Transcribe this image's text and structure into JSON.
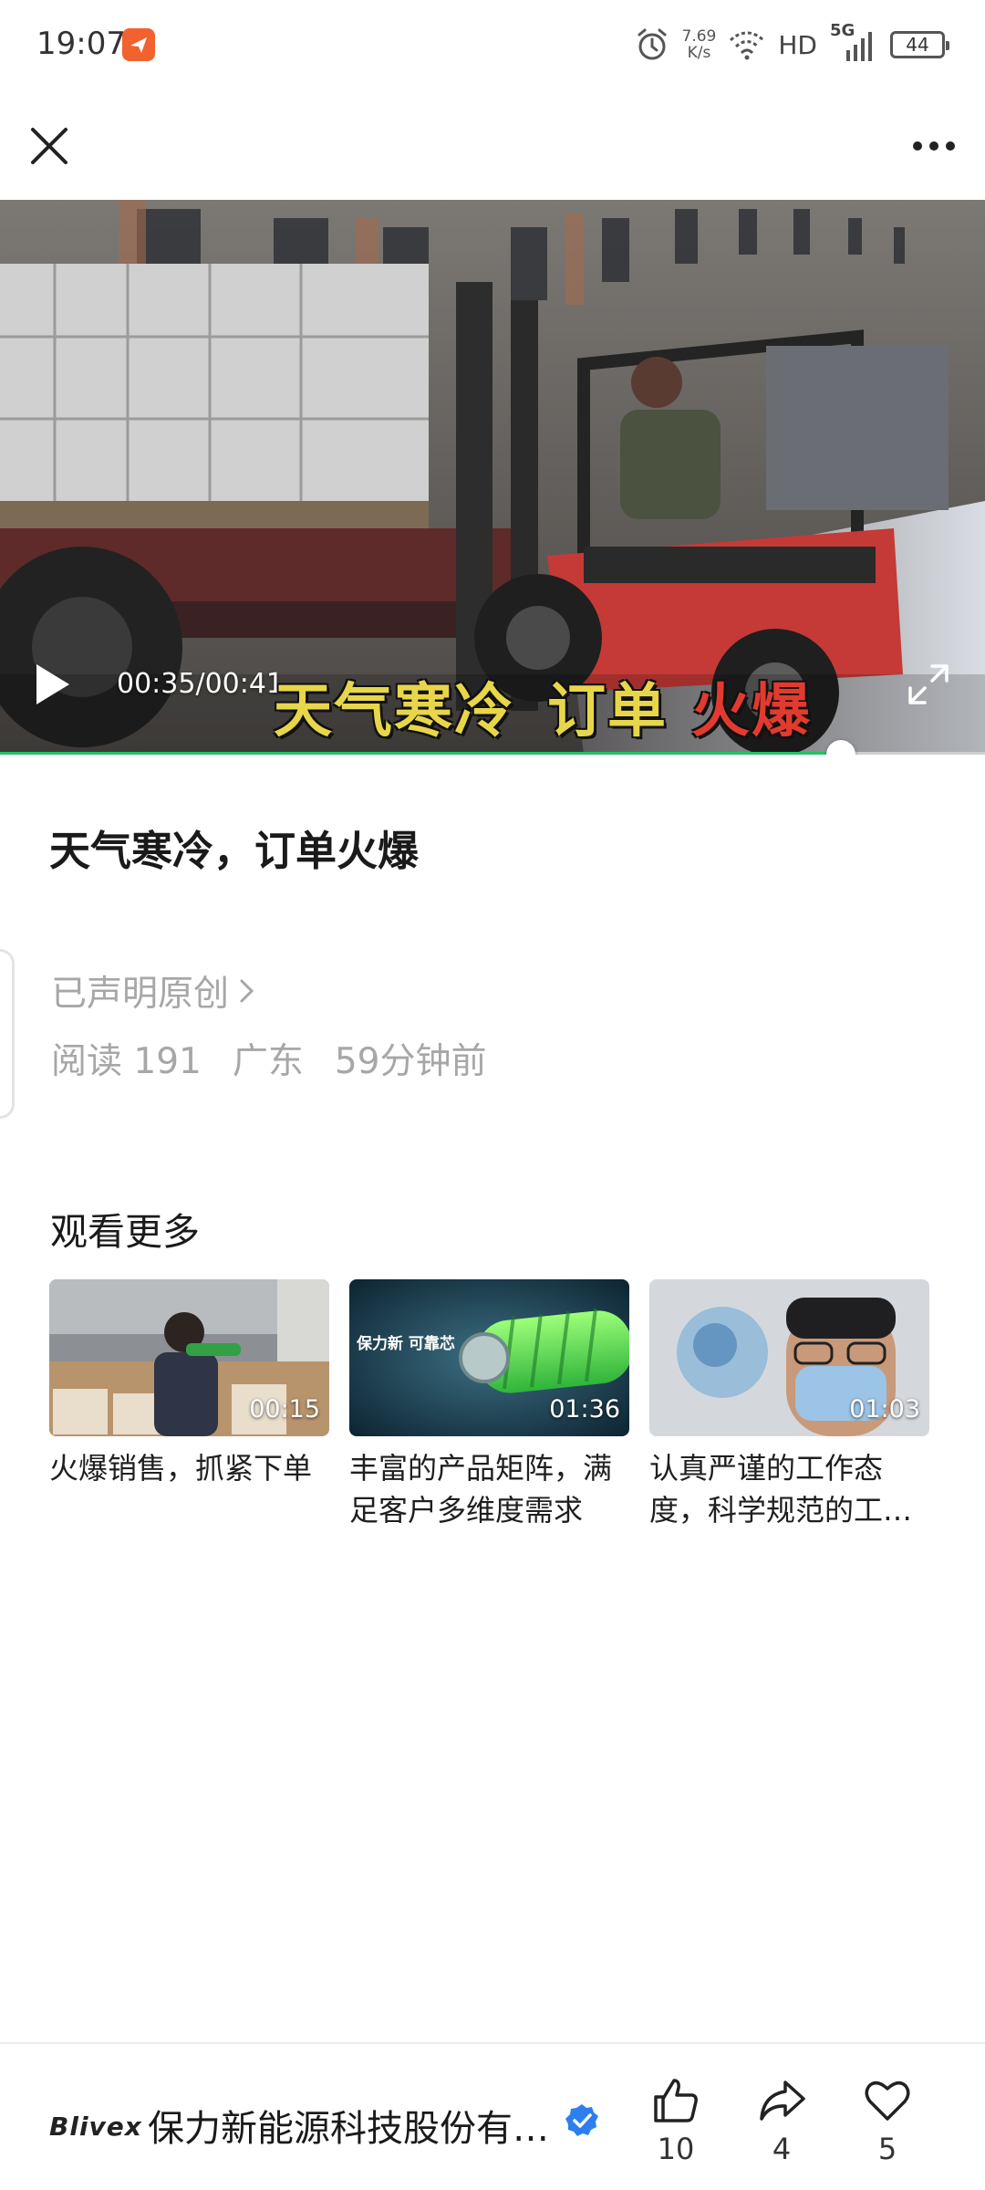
{
  "status_bar": {
    "time": "19:07",
    "net_speed_value": "7.69",
    "net_speed_unit": "K/s",
    "hd": "HD",
    "signal": "5G",
    "battery": "44"
  },
  "video": {
    "time": "00:35/00:41",
    "progress": 0.8537,
    "subtitle_part1": "天气寒冷",
    "subtitle_part2": "订单",
    "subtitle_part3": "火爆"
  },
  "article": {
    "title": "天气寒冷，订单火爆",
    "original_tag": "已声明原创",
    "reads": "阅读 191",
    "location": "广东",
    "time_ago": "59分钟前"
  },
  "more": {
    "heading": "观看更多",
    "cards": [
      {
        "duration": "00:15",
        "title": "火爆销售，抓紧下单"
      },
      {
        "duration": "01:36",
        "title": "丰富的产品矩阵，满足客户多维度需求",
        "thumb_text": "保力新 可靠芯"
      },
      {
        "duration": "01:03",
        "title": "认真严谨的工作态度，科学规范的工…"
      }
    ]
  },
  "bottom_bar": {
    "brand_logo": "Blivex",
    "account_name": "保力新能源科技股份有…",
    "like_count": "10",
    "share_count": "4",
    "favorite_count": "5"
  },
  "colors": {
    "progress": "#25c16a",
    "verified": "#2d7ff0",
    "app_icon": "#f2622e"
  },
  "icons": [
    "close-icon",
    "more-icon",
    "play-icon",
    "fullscreen-icon",
    "chevron-right-icon",
    "verified-icon",
    "thumbs-up-icon",
    "share-icon",
    "heart-icon"
  ]
}
